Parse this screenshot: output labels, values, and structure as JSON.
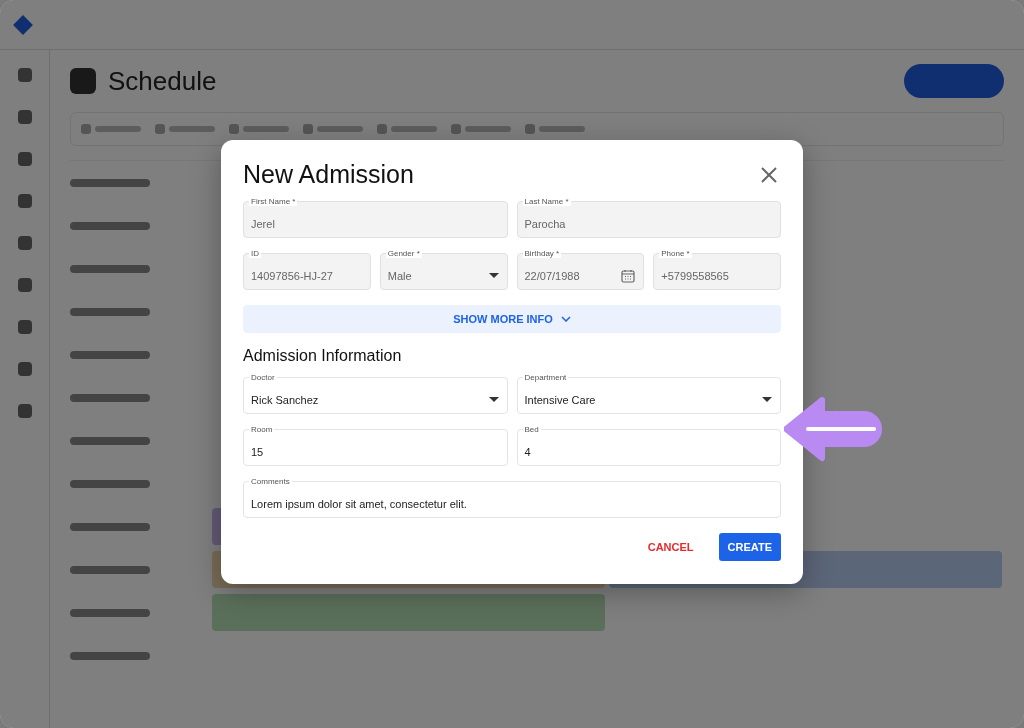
{
  "background": {
    "page_title": "Schedule"
  },
  "dialog": {
    "title": "New Admission",
    "patient_rows": [
      [
        {
          "label": "First Name *",
          "value": "Jerel",
          "kind": "text",
          "disabled": true
        },
        {
          "label": "Last Name *",
          "value": "Parocha",
          "kind": "text",
          "disabled": true
        }
      ],
      [
        {
          "label": "ID",
          "value": "14097856-HJ-27",
          "kind": "text",
          "disabled": true
        },
        {
          "label": "Gender *",
          "value": "Male",
          "kind": "select",
          "disabled": true
        },
        {
          "label": "Birthday *",
          "value": "22/07/1988",
          "kind": "date",
          "disabled": true
        },
        {
          "label": "Phone *",
          "value": "+5799558565",
          "kind": "text",
          "disabled": true
        }
      ]
    ],
    "show_more": {
      "label": "SHOW MORE INFO",
      "expanded": false
    },
    "section_title": "Admission Information",
    "admission_rows": [
      [
        {
          "label": "Doctor",
          "value": "Rick Sanchez",
          "kind": "select",
          "disabled": false
        },
        {
          "label": "Department",
          "value": "Intensive Care",
          "kind": "select",
          "disabled": false
        }
      ],
      [
        {
          "label": "Room",
          "value": "15",
          "kind": "text",
          "disabled": false
        },
        {
          "label": "Bed",
          "value": "4",
          "kind": "text",
          "disabled": false
        }
      ],
      [
        {
          "label": "Comments",
          "value": "Lorem ipsum dolor sit amet, consectetur elit.",
          "kind": "text",
          "disabled": false
        }
      ]
    ],
    "buttons": [
      {
        "label": "CANCEL",
        "kind": "text"
      },
      {
        "label": "CREATE",
        "kind": "primary"
      }
    ]
  }
}
